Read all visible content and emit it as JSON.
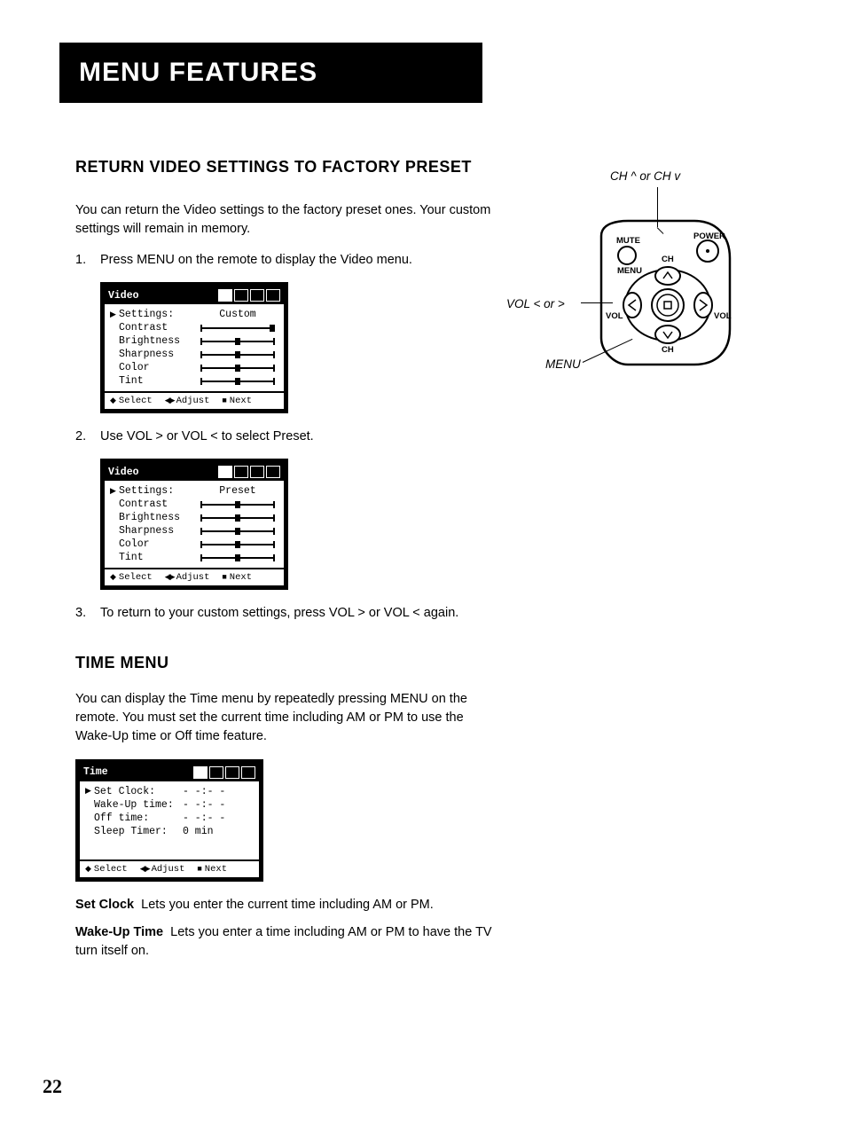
{
  "banner": {
    "title": "Menu Features"
  },
  "section1": {
    "heading": "Return Video Settings to Factory Preset",
    "intro": "You can return the Video settings to the factory preset ones. Your custom settings will remain in memory.",
    "step1": "Press MENU on the remote to display the Video menu.",
    "step2": "Use VOL > or VOL <  to select Preset.",
    "step3": "To return to your custom settings, press VOL > or VOL < again."
  },
  "osd_video": {
    "title": "Video",
    "rows": {
      "settings": "Settings:",
      "contrast": "Contrast",
      "brightness": "Brightness",
      "sharpness": "Sharpness",
      "color": "Color",
      "tint": "Tint"
    },
    "value_custom": "Custom",
    "value_preset": "Preset",
    "footer": {
      "select": "Select",
      "adjust": "Adjust",
      "next": "Next"
    },
    "sliders": {
      "contrast": 100,
      "brightness": 50,
      "sharpness": 50,
      "color": 50,
      "tint": 50
    },
    "sliders_preset": {
      "contrast": 50,
      "brightness": 50,
      "sharpness": 50,
      "color": 50,
      "tint": 50
    }
  },
  "section2": {
    "heading": "Time Menu",
    "intro": "You can display the Time menu by repeatedly pressing MENU on the remote. You must set the current time including AM or PM to use the Wake-Up time or Off time feature."
  },
  "osd_time": {
    "title": "Time",
    "rows": {
      "set_clock": "Set Clock:",
      "wake_up": "Wake-Up time:",
      "off_time": "Off time:",
      "sleep": "Sleep Timer:"
    },
    "values": {
      "set_clock": "- -:- -",
      "wake_up": "- -:- -",
      "off_time": "- -:- -",
      "sleep": "0 min"
    },
    "footer": {
      "select": "Select",
      "adjust": "Adjust",
      "next": "Next"
    }
  },
  "definitions": {
    "set_clock_term": "Set Clock",
    "set_clock_def": "Lets you enter the current time including AM or PM.",
    "wake_up_term": "Wake-Up Time",
    "wake_up_def": "Lets you enter a time including AM or PM to have the TV turn itself on."
  },
  "remote": {
    "top_label": "CH ^ or CH v",
    "left_label": "VOL  < or >",
    "bottom_label": "MENU",
    "mute": "MUTE",
    "power": "POWER",
    "ch": "CH",
    "menu": "MENU",
    "vol": "VOL"
  },
  "page_number": "22"
}
